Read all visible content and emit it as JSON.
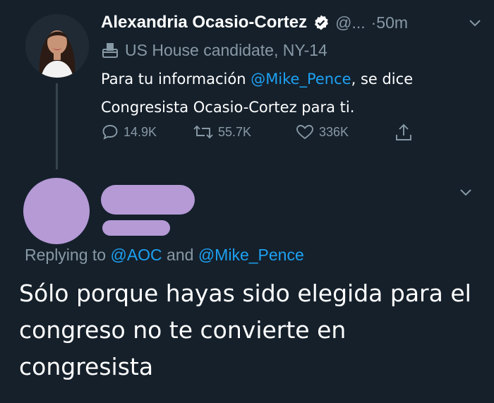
{
  "tweet": {
    "author_name": "Alexandria Ocasio-Cortez",
    "handle": "@...",
    "time": "·50m",
    "label": "US House candidate, NY-14",
    "text_before": "Para tu información ",
    "mention": "@Mike_Pence",
    "text_after": ", se dice Congresista Ocasio-Cortez para ti.",
    "stats": {
      "replies": "14.9K",
      "retweets": "55.7K",
      "likes": "336K"
    },
    "icons": {
      "reply": "reply-icon",
      "retweet": "retweet-icon",
      "like": "heart-icon",
      "share": "share-icon",
      "verified": "verified-badge-icon",
      "label": "ballot-box-icon",
      "caret": "chevron-down-icon"
    }
  },
  "reply": {
    "replying_prefix": "Replying to ",
    "replying_to_1": "@AOC",
    "replying_and": " and ",
    "replying_to_2": "@Mike_Pence",
    "text": "Sólo porque hayas sido elegida para el congreso no te convierte en congresista",
    "redaction_color": "#b59ad6"
  },
  "colors": {
    "background": "#15202b",
    "text": "#ffffff",
    "muted": "#8899a6",
    "link": "#1da1f2"
  }
}
